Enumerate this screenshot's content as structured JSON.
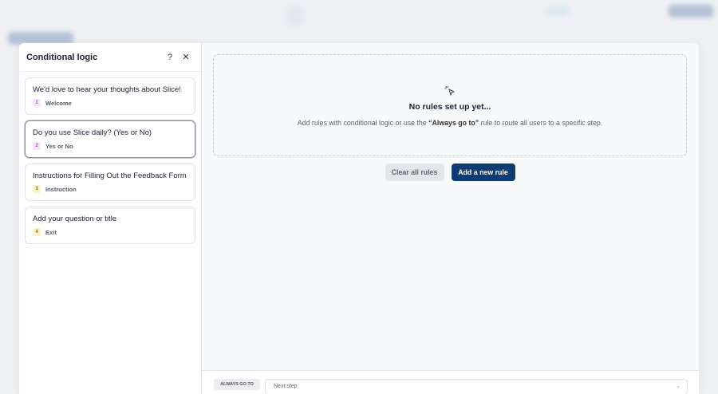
{
  "panel": {
    "title": "Conditional logic",
    "help_icon": "?",
    "close_icon": "✕"
  },
  "steps": [
    {
      "title": "We'd love to hear your thoughts about Slice!",
      "number": "1",
      "type": "Welcome"
    },
    {
      "title": "Do you use Slice daily? (Yes or No)",
      "number": "2",
      "type": "Yes or No"
    },
    {
      "title": "Instructions for Filling Out the Feedback Form",
      "number": "3",
      "type": "Instruction"
    },
    {
      "title": "Add your question or title",
      "number": "4",
      "type": "Exit"
    }
  ],
  "empty_state": {
    "title": "No rules set up yet...",
    "desc_before": "Add rules with conditional logic or use the ",
    "desc_bold": "“Always go to”",
    "desc_after": " rule to route all users to a specific step."
  },
  "buttons": {
    "clear": "Clear all rules",
    "add": "Add a new rule"
  },
  "footer": {
    "badge": "ALWAYS GO TO",
    "select_value": "Next step"
  }
}
